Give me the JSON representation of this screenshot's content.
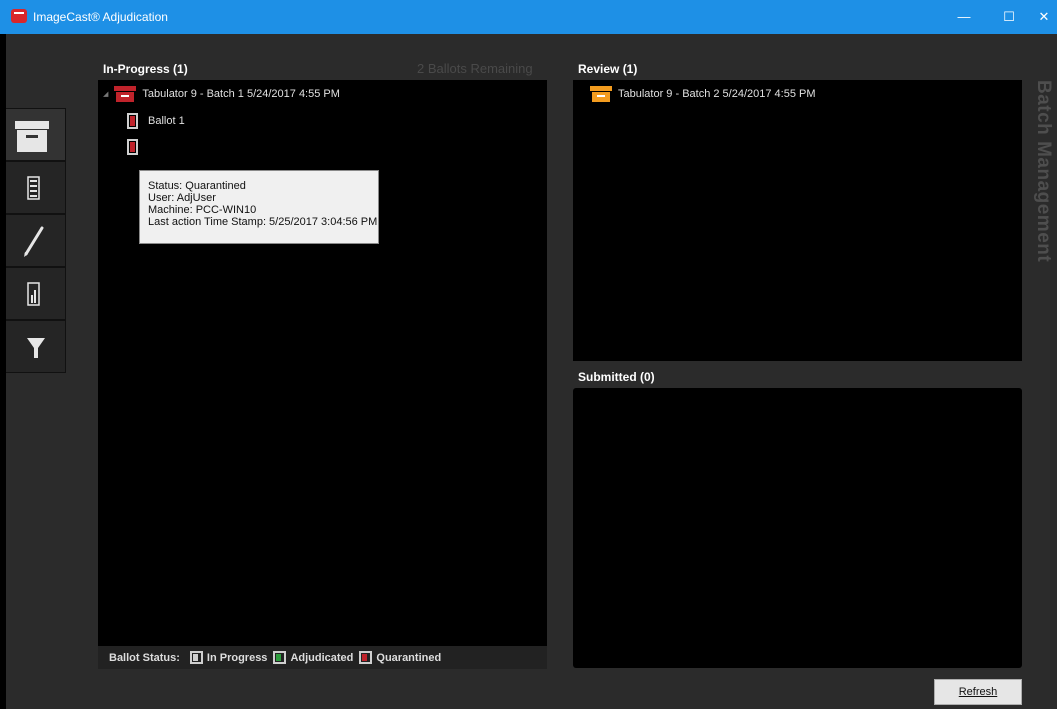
{
  "window": {
    "title": "ImageCast® Adjudication",
    "minimize_glyph": "—",
    "maximize_glyph": "☐",
    "close_glyph": "✕"
  },
  "toolbar": {
    "items": [
      "archive-box-icon",
      "ballot-list-icon",
      "pencil-icon",
      "report-icon",
      "filter-icon"
    ]
  },
  "in_progress": {
    "title": "In-Progress (1)",
    "remaining": "2 Ballots Remaining",
    "batch_label": "Tabulator 9 - Batch 1   5/24/2017 4:55 PM",
    "ballots": [
      "Ballot 1"
    ],
    "tooltip": {
      "status": "Status: Quarantined",
      "user": "User: AdjUser",
      "machine": "Machine: PCC-WIN10",
      "timestamp": "Last action Time Stamp: 5/25/2017 3:04:56 PM"
    }
  },
  "review": {
    "title": "Review (1)",
    "batch_label": "Tabulator 9 - Batch 2   5/24/2017 4:55 PM"
  },
  "submitted": {
    "title": "Submitted (0)"
  },
  "status_legend": {
    "label": "Ballot Status:",
    "in_progress": "In Progress",
    "adjudicated": "Adjudicated",
    "quarantined": "Quarantined"
  },
  "side_label": "Batch Management",
  "refresh_label": "Refresh",
  "colors": {
    "titlebar": "#1e90e6",
    "quarantined": "#c0232b",
    "review_batch": "#f39c1f",
    "adjudicated": "#2e9e3e",
    "in_progress": "#cfcfcf"
  }
}
